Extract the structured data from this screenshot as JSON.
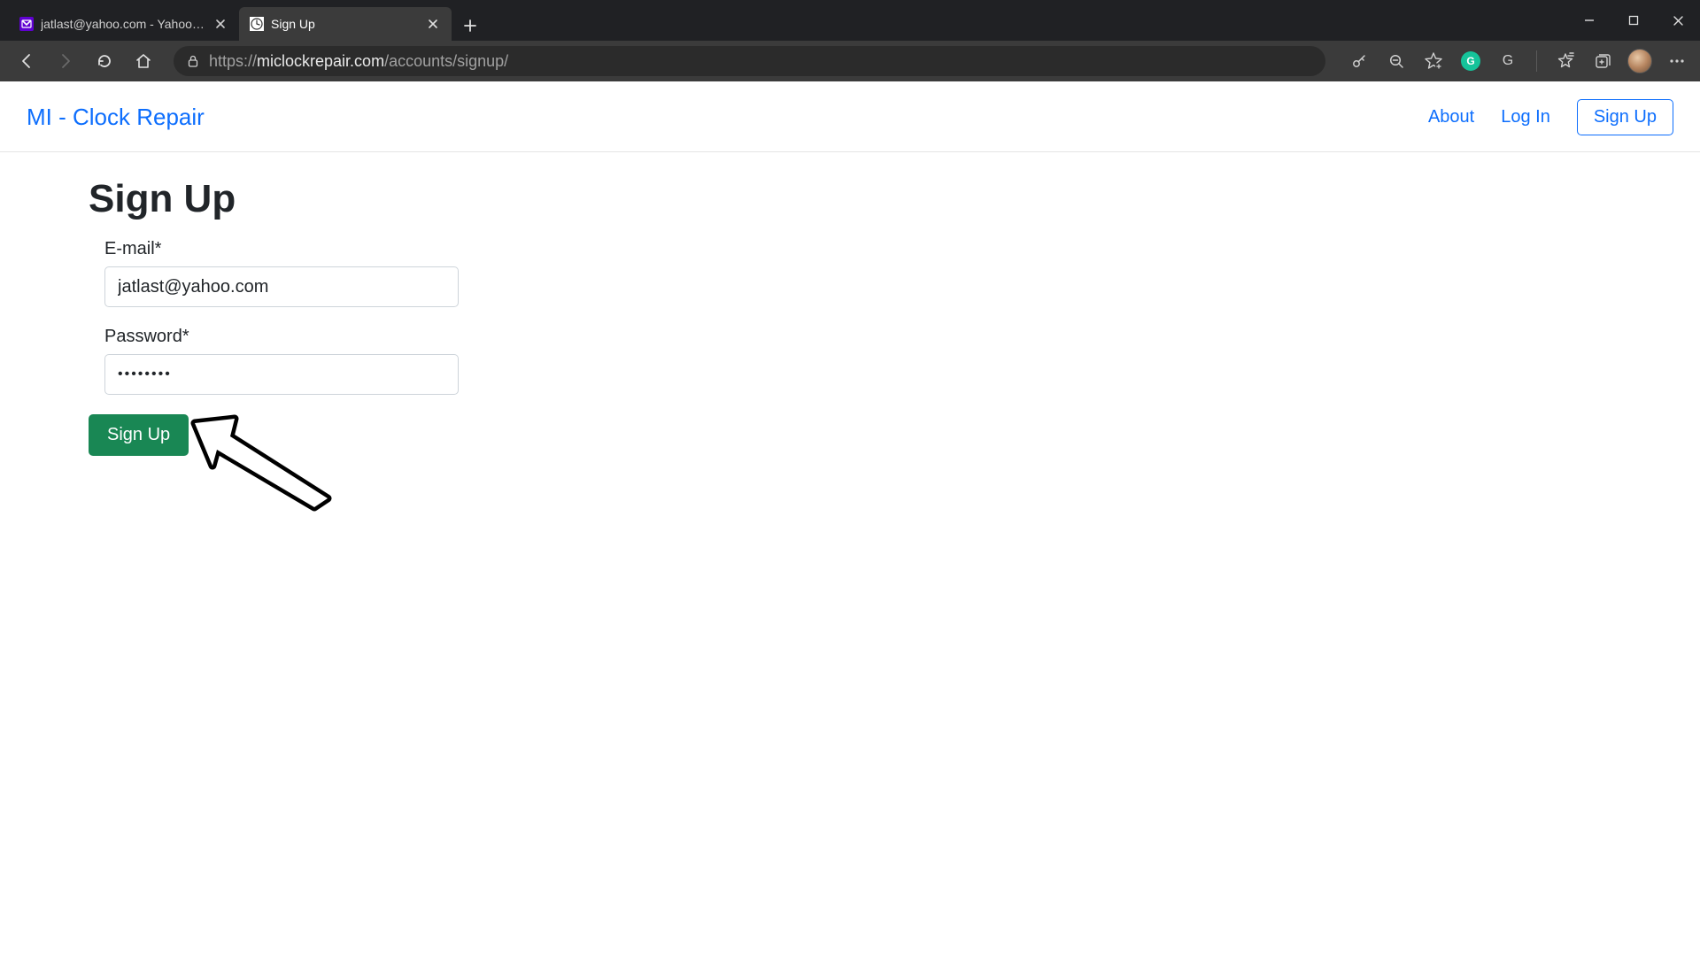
{
  "browser": {
    "tabs": [
      {
        "title": "jatlast@yahoo.com - Yahoo Mail",
        "active": false
      },
      {
        "title": "Sign Up",
        "active": true
      }
    ],
    "url": {
      "protocol": "https://",
      "host": "miclockrepair.com",
      "path": "/accounts/signup/"
    }
  },
  "site": {
    "brand": "MI - Clock Repair",
    "nav": {
      "about": "About",
      "login": "Log In",
      "signup": "Sign Up"
    }
  },
  "form": {
    "heading": "Sign Up",
    "email_label": "E-mail*",
    "email_value": "jatlast@yahoo.com",
    "password_label": "Password*",
    "password_mask": "••••••••",
    "submit_label": "Sign Up"
  }
}
